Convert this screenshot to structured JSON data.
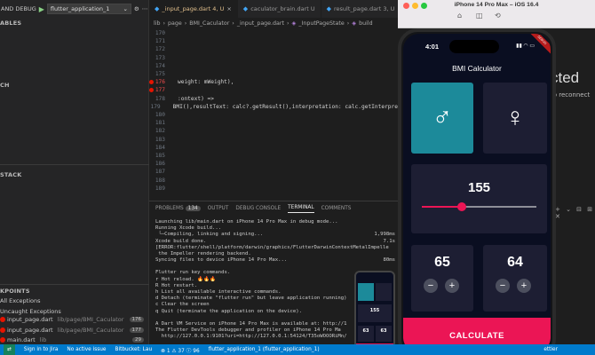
{
  "sidebar": {
    "debug_label": "AND DEBUG",
    "config_name": "flutter_application_1",
    "sections": [
      "ABLES",
      "CH",
      "STACK"
    ],
    "breakpoints_title": "KPOINTS",
    "breakpoints": [
      {
        "label": "All Exceptions",
        "checked": false
      },
      {
        "label": "Uncaught Exceptions",
        "checked": false
      },
      {
        "label": "input_page.dart",
        "path": "lib/page/BMI_Caculator",
        "line": "176"
      },
      {
        "label": "input_page.dart",
        "path": "lib/page/BMI_Caculator",
        "line": "177"
      },
      {
        "label": "main.dart",
        "path": "lib",
        "line": "29"
      }
    ]
  },
  "tabs": [
    {
      "label": "_input_page.dart 4, U",
      "active": true
    },
    {
      "label": "caculator_brain.dart U",
      "active": false
    },
    {
      "label": "result_page.dart 3, U",
      "active": false
    }
  ],
  "breadcrumb": [
    "lib",
    "page",
    "BMI_Caculator",
    "_input_page.dart",
    "_InputPageState",
    "build"
  ],
  "code": {
    "lines": [
      {
        "n": "170",
        "text": ""
      },
      {
        "n": "171",
        "text": ""
      },
      {
        "n": "172",
        "text": ""
      },
      {
        "n": "173",
        "text": ""
      },
      {
        "n": "174",
        "text": ""
      },
      {
        "n": "175",
        "text": ""
      },
      {
        "n": "176",
        "text": "weight: mWeight),",
        "bp": true
      },
      {
        "n": "177",
        "text": "",
        "bp": true
      },
      {
        "n": "178",
        "text": ":ontext) =>"
      },
      {
        "n": "179",
        "text": "BMI(),resultText: calc?.getResult(),interpretation: calc.getInterpre"
      },
      {
        "n": "180",
        "text": ""
      },
      {
        "n": "181",
        "text": ""
      },
      {
        "n": "182",
        "text": ""
      },
      {
        "n": "183",
        "text": ""
      },
      {
        "n": "184",
        "text": ""
      },
      {
        "n": "185",
        "text": ""
      },
      {
        "n": "186",
        "text": ""
      },
      {
        "n": "187",
        "text": ""
      },
      {
        "n": "188",
        "text": ""
      },
      {
        "n": "189",
        "text": ""
      }
    ]
  },
  "panel": {
    "tabs": [
      "PROBLEMS",
      "OUTPUT",
      "DEBUG CONSOLE",
      "TERMINAL",
      "COMMENTS"
    ],
    "problems_count": "134",
    "active_tab": "TERMINAL",
    "terminal": [
      {
        "l": "Launching lib/main.dart on iPhone 14 Pro Max in debug mode...",
        "r": ""
      },
      {
        "l": "Running Xcode build...",
        "r": ""
      },
      {
        "l": " └─Compiling, linking and signing...",
        "r": "1,998ms"
      },
      {
        "l": "Xcode build done.",
        "r": "7.1s"
      },
      {
        "l": "[ERROR:flutter/shell/platform/darwin/graphics/FlutterDarwinContextMetalImpelle",
        "r": ""
      },
      {
        "l": " the Impeller rendering backend.",
        "r": ""
      },
      {
        "l": "Syncing files to device iPhone 14 Pro Max...",
        "r": "80ms"
      },
      {
        "l": "",
        "r": ""
      },
      {
        "l": "Flutter run key commands.",
        "r": ""
      },
      {
        "l": "r Hot reload. 🔥🔥🔥",
        "r": ""
      },
      {
        "l": "R Hot restart.",
        "r": ""
      },
      {
        "l": "h List all available interactive commands.",
        "r": ""
      },
      {
        "l": "d Detach (terminate \"flutter run\" but leave application running)",
        "r": ""
      },
      {
        "l": "c Clear the screen",
        "r": ""
      },
      {
        "l": "q Quit (terminate the application on the device).",
        "r": ""
      },
      {
        "l": "",
        "r": ""
      },
      {
        "l": "A Dart VM Service on iPhone 14 Pro Max is available at: http://1",
        "r": ""
      },
      {
        "l": "The Flutter DevTools debugger and profiler on iPhone 14 Pro Ma",
        "r": ""
      },
      {
        "l": "  http://127.0.0.1:9101?uri=http://127.0.0.1:54124/T35oWOOORiMn/",
        "r": ""
      }
    ]
  },
  "statusbar": {
    "items": [
      "Sign in to Jira",
      "No active issue",
      "Bitbucket: Lau",
      "⊗ 1 ⚠ 37 ⓘ 96",
      "flutter_application_1 (flutter_application_1)"
    ],
    "right": "ettier"
  },
  "background": {
    "title": "cted",
    "subtitle": "to reconnect"
  },
  "simulator": {
    "title": "iPhone 14 Pro Max – iOS 16.4",
    "time": "4:01",
    "debug_banner": "DEBUG",
    "app_title": "BMI Calculator",
    "male_symbol": "♂",
    "female_symbol": "♀",
    "selected_gender": "male",
    "height": "155",
    "height_fraction": 0.35,
    "weight": "65",
    "age": "64",
    "minus": "−",
    "plus": "+",
    "calculate": "CALCULATE",
    "accent": "#eb1555",
    "card_color": "#1d1e33",
    "selected_color": "#1c8a9a"
  },
  "mini_phone": {
    "height": "155",
    "weight": "63",
    "age": "63"
  }
}
